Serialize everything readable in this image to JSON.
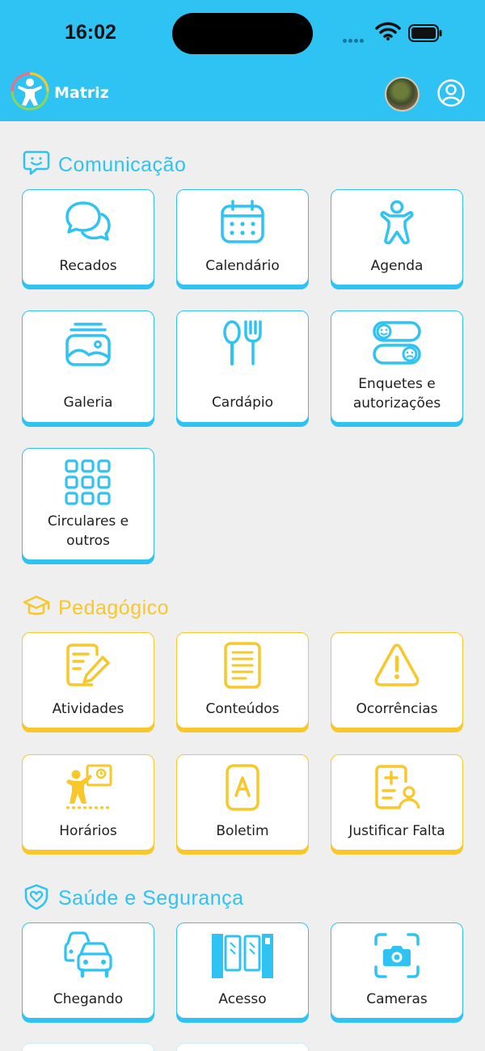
{
  "status_bar": {
    "time": "16:02"
  },
  "header": {
    "school_name": "Matriz"
  },
  "colors": {
    "accent_blue": "#2ec3f2",
    "accent_yellow": "#f8c72a",
    "background": "#efefef"
  },
  "sections": [
    {
      "title": "Comunicação",
      "icon": "chat-smile-icon",
      "items": [
        {
          "label": "Recados",
          "icon": "chat-bubbles-icon"
        },
        {
          "label": "Calendário",
          "icon": "calendar-icon"
        },
        {
          "label": "Agenda",
          "icon": "child-figure-icon"
        },
        {
          "label": "Galeria",
          "icon": "gallery-icon"
        },
        {
          "label": "Cardápio",
          "icon": "spoon-fork-icon"
        },
        {
          "label": "Enquetes e autorizações",
          "icon": "poll-toggles-icon"
        },
        {
          "label": "Circulares e outros",
          "icon": "grid-dots-icon"
        }
      ]
    },
    {
      "title": "Pedagógico",
      "icon": "graduation-cap-icon",
      "items": [
        {
          "label": "Atividades",
          "icon": "document-edit-icon"
        },
        {
          "label": "Conteúdos",
          "icon": "document-lines-icon"
        },
        {
          "label": "Ocorrências",
          "icon": "warning-icon"
        },
        {
          "label": "Horários",
          "icon": "teacher-board-icon"
        },
        {
          "label": "Boletim",
          "icon": "grade-a-icon"
        },
        {
          "label": "Justificar Falta",
          "icon": "medical-form-icon"
        }
      ]
    },
    {
      "title": "Saúde e Segurança",
      "icon": "shield-heart-icon",
      "items": [
        {
          "label": "Chegando",
          "icon": "cars-icon"
        },
        {
          "label": "Acesso",
          "icon": "turnstile-icon"
        },
        {
          "label": "Cameras",
          "icon": "camera-icon"
        }
      ]
    }
  ]
}
